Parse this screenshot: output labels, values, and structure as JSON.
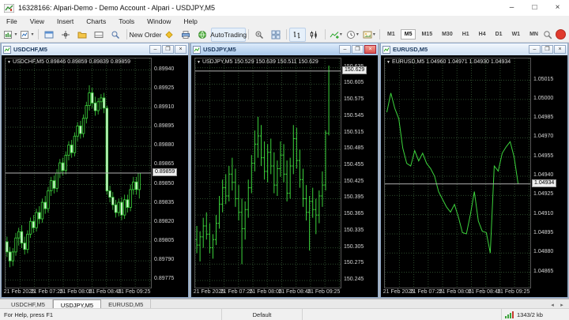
{
  "window": {
    "title": "16328166: Alpari-Demo - Demo Account - Alpari - USDJPY,M5"
  },
  "menu": {
    "items": [
      "File",
      "View",
      "Insert",
      "Charts",
      "Tools",
      "Window",
      "Help"
    ]
  },
  "toolbar": {
    "new_order_label": "New Order",
    "autotrading_label": "AutoTrading",
    "timeframes": [
      "M1",
      "M5",
      "M15",
      "M30",
      "H1",
      "H4",
      "D1",
      "W1",
      "MN"
    ],
    "active_timeframe": "M5"
  },
  "colors": {
    "chart_bg": "#000000",
    "grid": "#2c4a2c",
    "series": "#3cd43c",
    "bear_fill": "#d9f2d9",
    "bull_fill": "#000000",
    "price_line": "#b0b0b0",
    "axis_text": "#d4d4d4"
  },
  "charts": [
    {
      "id": "usdchf",
      "window_title": "USDCHF,M5",
      "active": false,
      "chart_type": "candle",
      "ohlc": "USDCHF,M5  0.89846 0.89859 0.89839 0.89859",
      "price": 0.89859,
      "price_label": "0.89859",
      "ylim": [
        0.89769,
        0.89949
      ],
      "yticks": [
        "0.89940",
        "0.89925",
        "0.89910",
        "0.89895",
        "0.89880",
        "0.89865",
        "0.89850",
        "0.89835",
        "0.89820",
        "0.89805",
        "0.89790",
        "0.89775"
      ],
      "xticks": [
        "21 Feb 2025",
        "21 Feb 07:25",
        "21 Feb 08:05",
        "21 Feb 08:45",
        "21 Feb 09:25"
      ],
      "candles": [
        [
          0.89805,
          0.89809,
          0.89793,
          0.89797
        ],
        [
          0.89797,
          0.89801,
          0.89785,
          0.8979
        ],
        [
          0.8979,
          0.898,
          0.89786,
          0.89797
        ],
        [
          0.89797,
          0.89812,
          0.89794,
          0.89808
        ],
        [
          0.89808,
          0.89816,
          0.89802,
          0.89813
        ],
        [
          0.89813,
          0.89818,
          0.898,
          0.89804
        ],
        [
          0.89804,
          0.89809,
          0.89795,
          0.89799
        ],
        [
          0.89799,
          0.89814,
          0.89796,
          0.89811
        ],
        [
          0.89811,
          0.89824,
          0.89808,
          0.89821
        ],
        [
          0.89821,
          0.89826,
          0.89812,
          0.89816
        ],
        [
          0.89816,
          0.89831,
          0.89813,
          0.89828
        ],
        [
          0.89828,
          0.89833,
          0.89819,
          0.89823
        ],
        [
          0.89823,
          0.89839,
          0.8982,
          0.89836
        ],
        [
          0.89836,
          0.89841,
          0.89827,
          0.89831
        ],
        [
          0.89831,
          0.89848,
          0.89828,
          0.89845
        ],
        [
          0.89845,
          0.89856,
          0.89841,
          0.89853
        ],
        [
          0.89853,
          0.89857,
          0.89843,
          0.89847
        ],
        [
          0.89847,
          0.89862,
          0.89844,
          0.89859
        ],
        [
          0.89859,
          0.8987,
          0.89855,
          0.89867
        ],
        [
          0.89867,
          0.89871,
          0.89857,
          0.89861
        ],
        [
          0.89861,
          0.89876,
          0.89858,
          0.89873
        ],
        [
          0.89873,
          0.89884,
          0.89869,
          0.89881
        ],
        [
          0.89881,
          0.89885,
          0.89871,
          0.89875
        ],
        [
          0.89875,
          0.89891,
          0.89872,
          0.89888
        ],
        [
          0.89888,
          0.89899,
          0.89884,
          0.89896
        ],
        [
          0.89896,
          0.899,
          0.89886,
          0.8989
        ],
        [
          0.8989,
          0.89905,
          0.89887,
          0.89902
        ],
        [
          0.89902,
          0.89915,
          0.89898,
          0.89912
        ],
        [
          0.89912,
          0.89928,
          0.89908,
          0.89922
        ],
        [
          0.89922,
          0.89926,
          0.8991,
          0.89914
        ],
        [
          0.89914,
          0.89919,
          0.89904,
          0.89908
        ],
        [
          0.89908,
          0.89918,
          0.89905,
          0.89915
        ],
        [
          0.89915,
          0.89921,
          0.89909,
          0.89918
        ],
        [
          0.89918,
          0.89922,
          0.89906,
          0.8991
        ],
        [
          0.8991,
          0.89912,
          0.89842,
          0.89845
        ],
        [
          0.89845,
          0.89849,
          0.89836,
          0.8984
        ],
        [
          0.8984,
          0.89844,
          0.8983,
          0.89834
        ],
        [
          0.89834,
          0.89838,
          0.89824,
          0.89828
        ],
        [
          0.89828,
          0.89839,
          0.89825,
          0.89836
        ],
        [
          0.89836,
          0.8984,
          0.89822,
          0.89826
        ],
        [
          0.89826,
          0.89842,
          0.89823,
          0.89838
        ],
        [
          0.89838,
          0.89842,
          0.89828,
          0.89832
        ],
        [
          0.89832,
          0.8985,
          0.89829,
          0.89846
        ],
        [
          0.89846,
          0.89856,
          0.89842,
          0.89852
        ],
        [
          0.89852,
          0.89856,
          0.89842,
          0.89846
        ],
        [
          0.89846,
          0.89859,
          0.89839,
          0.89859
        ]
      ]
    },
    {
      "id": "usdjpy",
      "window_title": "USDJPY,M5",
      "active": true,
      "chart_type": "bar",
      "ohlc": "USDJPY,M5  150.529 150.639 150.511 150.629",
      "price": 150.629,
      "price_label": "150.629",
      "ylim": [
        150.232,
        150.652
      ],
      "yticks": [
        "150.635",
        "150.605",
        "150.575",
        "150.545",
        "150.515",
        "150.485",
        "150.455",
        "150.425",
        "150.395",
        "150.365",
        "150.335",
        "150.305",
        "150.275",
        "150.245"
      ],
      "xticks": [
        "21 Feb 2025",
        "21 Feb 07:25",
        "21 Feb 08:05",
        "21 Feb 08:45",
        "21 Feb 09:25"
      ],
      "bars": [
        [
          150.32,
          150.345,
          150.295,
          150.31
        ],
        [
          150.31,
          150.335,
          150.28,
          150.325
        ],
        [
          150.325,
          150.36,
          150.305,
          150.345
        ],
        [
          150.345,
          150.37,
          150.32,
          150.33
        ],
        [
          150.33,
          150.35,
          150.295,
          150.305
        ],
        [
          150.305,
          150.33,
          150.285,
          150.32
        ],
        [
          150.32,
          150.365,
          150.31,
          150.35
        ],
        [
          150.35,
          150.4,
          150.34,
          150.385
        ],
        [
          150.385,
          150.43,
          150.37,
          150.415
        ],
        [
          150.415,
          150.44,
          150.385,
          150.4
        ],
        [
          150.4,
          150.455,
          150.39,
          150.44
        ],
        [
          150.44,
          150.47,
          150.41,
          150.425
        ],
        [
          150.425,
          150.45,
          150.38,
          150.395
        ],
        [
          150.395,
          150.42,
          150.355,
          150.37
        ],
        [
          150.37,
          150.395,
          150.275,
          150.34
        ],
        [
          150.34,
          150.39,
          150.32,
          150.375
        ],
        [
          150.375,
          150.43,
          150.36,
          150.415
        ],
        [
          150.415,
          150.475,
          150.405,
          150.46
        ],
        [
          150.46,
          150.52,
          150.445,
          150.495
        ],
        [
          150.495,
          150.545,
          150.47,
          150.51
        ],
        [
          150.51,
          150.53,
          150.455,
          150.47
        ],
        [
          150.47,
          150.5,
          150.43,
          150.445
        ],
        [
          150.445,
          150.495,
          150.425,
          150.48
        ],
        [
          150.48,
          150.505,
          150.44,
          150.455
        ],
        [
          150.455,
          150.48,
          150.405,
          150.42
        ],
        [
          150.42,
          150.465,
          150.4,
          150.45
        ],
        [
          150.45,
          150.5,
          150.435,
          150.475
        ],
        [
          150.475,
          150.495,
          150.425,
          150.44
        ],
        [
          150.44,
          150.465,
          150.39,
          150.405
        ],
        [
          150.405,
          150.47,
          150.395,
          150.455
        ],
        [
          150.455,
          150.53,
          150.44,
          150.505
        ],
        [
          150.505,
          150.525,
          150.45,
          150.465
        ],
        [
          150.465,
          150.485,
          150.415,
          150.43
        ],
        [
          150.43,
          150.45,
          150.38,
          150.395
        ],
        [
          150.395,
          150.42,
          150.355,
          150.37
        ],
        [
          150.37,
          150.4,
          150.3,
          150.39
        ],
        [
          150.39,
          150.415,
          150.36,
          150.375
        ],
        [
          150.375,
          150.395,
          150.33,
          150.365
        ],
        [
          150.365,
          150.41,
          150.35,
          150.4
        ],
        [
          150.4,
          150.445,
          150.38,
          150.42
        ],
        [
          150.42,
          150.52,
          150.41,
          150.515
        ],
        [
          150.515,
          150.639,
          150.511,
          150.629
        ]
      ]
    },
    {
      "id": "eurusd",
      "window_title": "EURUSD,M5",
      "active": false,
      "chart_type": "line",
      "ohlc": "EURUSD,M5  1.04960 1.04971 1.04930 1.04934",
      "price": 1.04934,
      "price_label": "1.04934",
      "ylim": [
        1.04853,
        1.05032
      ],
      "yticks": [
        "1.05015",
        "1.05000",
        "1.04985",
        "1.04970",
        "1.04955",
        "1.04940",
        "1.04925",
        "1.04910",
        "1.04895",
        "1.04880",
        "1.04865"
      ],
      "xticks": [
        "21 Feb 2025",
        "21 Feb 07:25",
        "21 Feb 08:05",
        "21 Feb 08:45",
        "21 Feb 09:25"
      ],
      "points": [
        1.0499,
        1.05005,
        1.04993,
        1.04985,
        1.04962,
        1.0495,
        1.04948,
        1.0496,
        1.04952,
        1.04958,
        1.0495,
        1.04946,
        1.0494,
        1.04928,
        1.04922,
        1.04916,
        1.04912,
        1.04918,
        1.04908,
        1.04896,
        1.04895,
        1.0491,
        1.04928,
        1.04905,
        1.04897,
        1.04896,
        1.0488,
        1.04948,
        1.04944,
        1.04958,
        1.04963,
        1.04967,
        1.04955,
        1.04934
      ]
    }
  ],
  "tabs": {
    "items": [
      "USDCHF,M5",
      "USDJPY,M5",
      "EURUSD,M5"
    ],
    "active": "USDJPY,M5"
  },
  "statusbar": {
    "help": "For Help, press F1",
    "profile": "Default",
    "connection": "1343/2 kb"
  }
}
